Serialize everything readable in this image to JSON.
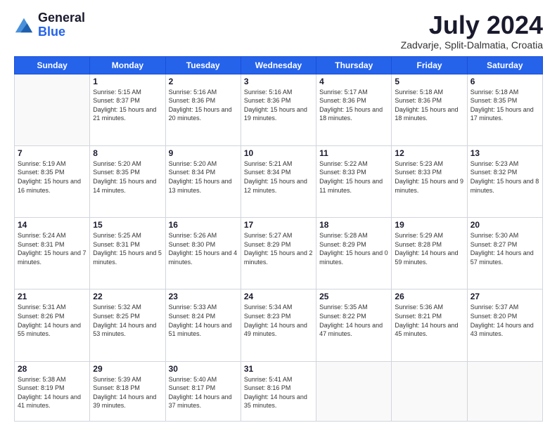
{
  "logo": {
    "general": "General",
    "blue": "Blue"
  },
  "header": {
    "month": "July 2024",
    "location": "Zadvarje, Split-Dalmatia, Croatia"
  },
  "weekdays": [
    "Sunday",
    "Monday",
    "Tuesday",
    "Wednesday",
    "Thursday",
    "Friday",
    "Saturday"
  ],
  "weeks": [
    [
      {
        "day": "",
        "sunrise": "",
        "sunset": "",
        "daylight": ""
      },
      {
        "day": "1",
        "sunrise": "Sunrise: 5:15 AM",
        "sunset": "Sunset: 8:37 PM",
        "daylight": "Daylight: 15 hours and 21 minutes."
      },
      {
        "day": "2",
        "sunrise": "Sunrise: 5:16 AM",
        "sunset": "Sunset: 8:36 PM",
        "daylight": "Daylight: 15 hours and 20 minutes."
      },
      {
        "day": "3",
        "sunrise": "Sunrise: 5:16 AM",
        "sunset": "Sunset: 8:36 PM",
        "daylight": "Daylight: 15 hours and 19 minutes."
      },
      {
        "day": "4",
        "sunrise": "Sunrise: 5:17 AM",
        "sunset": "Sunset: 8:36 PM",
        "daylight": "Daylight: 15 hours and 18 minutes."
      },
      {
        "day": "5",
        "sunrise": "Sunrise: 5:18 AM",
        "sunset": "Sunset: 8:36 PM",
        "daylight": "Daylight: 15 hours and 18 minutes."
      },
      {
        "day": "6",
        "sunrise": "Sunrise: 5:18 AM",
        "sunset": "Sunset: 8:35 PM",
        "daylight": "Daylight: 15 hours and 17 minutes."
      }
    ],
    [
      {
        "day": "7",
        "sunrise": "Sunrise: 5:19 AM",
        "sunset": "Sunset: 8:35 PM",
        "daylight": "Daylight: 15 hours and 16 minutes."
      },
      {
        "day": "8",
        "sunrise": "Sunrise: 5:20 AM",
        "sunset": "Sunset: 8:35 PM",
        "daylight": "Daylight: 15 hours and 14 minutes."
      },
      {
        "day": "9",
        "sunrise": "Sunrise: 5:20 AM",
        "sunset": "Sunset: 8:34 PM",
        "daylight": "Daylight: 15 hours and 13 minutes."
      },
      {
        "day": "10",
        "sunrise": "Sunrise: 5:21 AM",
        "sunset": "Sunset: 8:34 PM",
        "daylight": "Daylight: 15 hours and 12 minutes."
      },
      {
        "day": "11",
        "sunrise": "Sunrise: 5:22 AM",
        "sunset": "Sunset: 8:33 PM",
        "daylight": "Daylight: 15 hours and 11 minutes."
      },
      {
        "day": "12",
        "sunrise": "Sunrise: 5:23 AM",
        "sunset": "Sunset: 8:33 PM",
        "daylight": "Daylight: 15 hours and 9 minutes."
      },
      {
        "day": "13",
        "sunrise": "Sunrise: 5:23 AM",
        "sunset": "Sunset: 8:32 PM",
        "daylight": "Daylight: 15 hours and 8 minutes."
      }
    ],
    [
      {
        "day": "14",
        "sunrise": "Sunrise: 5:24 AM",
        "sunset": "Sunset: 8:31 PM",
        "daylight": "Daylight: 15 hours and 7 minutes."
      },
      {
        "day": "15",
        "sunrise": "Sunrise: 5:25 AM",
        "sunset": "Sunset: 8:31 PM",
        "daylight": "Daylight: 15 hours and 5 minutes."
      },
      {
        "day": "16",
        "sunrise": "Sunrise: 5:26 AM",
        "sunset": "Sunset: 8:30 PM",
        "daylight": "Daylight: 15 hours and 4 minutes."
      },
      {
        "day": "17",
        "sunrise": "Sunrise: 5:27 AM",
        "sunset": "Sunset: 8:29 PM",
        "daylight": "Daylight: 15 hours and 2 minutes."
      },
      {
        "day": "18",
        "sunrise": "Sunrise: 5:28 AM",
        "sunset": "Sunset: 8:29 PM",
        "daylight": "Daylight: 15 hours and 0 minutes."
      },
      {
        "day": "19",
        "sunrise": "Sunrise: 5:29 AM",
        "sunset": "Sunset: 8:28 PM",
        "daylight": "Daylight: 14 hours and 59 minutes."
      },
      {
        "day": "20",
        "sunrise": "Sunrise: 5:30 AM",
        "sunset": "Sunset: 8:27 PM",
        "daylight": "Daylight: 14 hours and 57 minutes."
      }
    ],
    [
      {
        "day": "21",
        "sunrise": "Sunrise: 5:31 AM",
        "sunset": "Sunset: 8:26 PM",
        "daylight": "Daylight: 14 hours and 55 minutes."
      },
      {
        "day": "22",
        "sunrise": "Sunrise: 5:32 AM",
        "sunset": "Sunset: 8:25 PM",
        "daylight": "Daylight: 14 hours and 53 minutes."
      },
      {
        "day": "23",
        "sunrise": "Sunrise: 5:33 AM",
        "sunset": "Sunset: 8:24 PM",
        "daylight": "Daylight: 14 hours and 51 minutes."
      },
      {
        "day": "24",
        "sunrise": "Sunrise: 5:34 AM",
        "sunset": "Sunset: 8:23 PM",
        "daylight": "Daylight: 14 hours and 49 minutes."
      },
      {
        "day": "25",
        "sunrise": "Sunrise: 5:35 AM",
        "sunset": "Sunset: 8:22 PM",
        "daylight": "Daylight: 14 hours and 47 minutes."
      },
      {
        "day": "26",
        "sunrise": "Sunrise: 5:36 AM",
        "sunset": "Sunset: 8:21 PM",
        "daylight": "Daylight: 14 hours and 45 minutes."
      },
      {
        "day": "27",
        "sunrise": "Sunrise: 5:37 AM",
        "sunset": "Sunset: 8:20 PM",
        "daylight": "Daylight: 14 hours and 43 minutes."
      }
    ],
    [
      {
        "day": "28",
        "sunrise": "Sunrise: 5:38 AM",
        "sunset": "Sunset: 8:19 PM",
        "daylight": "Daylight: 14 hours and 41 minutes."
      },
      {
        "day": "29",
        "sunrise": "Sunrise: 5:39 AM",
        "sunset": "Sunset: 8:18 PM",
        "daylight": "Daylight: 14 hours and 39 minutes."
      },
      {
        "day": "30",
        "sunrise": "Sunrise: 5:40 AM",
        "sunset": "Sunset: 8:17 PM",
        "daylight": "Daylight: 14 hours and 37 minutes."
      },
      {
        "day": "31",
        "sunrise": "Sunrise: 5:41 AM",
        "sunset": "Sunset: 8:16 PM",
        "daylight": "Daylight: 14 hours and 35 minutes."
      },
      {
        "day": "",
        "sunrise": "",
        "sunset": "",
        "daylight": ""
      },
      {
        "day": "",
        "sunrise": "",
        "sunset": "",
        "daylight": ""
      },
      {
        "day": "",
        "sunrise": "",
        "sunset": "",
        "daylight": ""
      }
    ]
  ]
}
